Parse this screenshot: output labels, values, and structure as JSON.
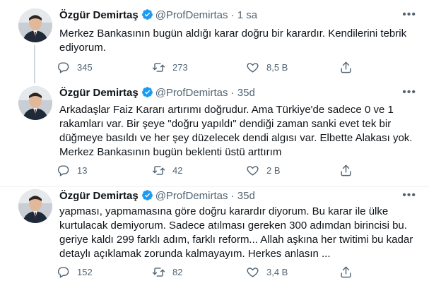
{
  "tweets": [
    {
      "name": "Özgür Demirtaş",
      "handle": "@ProfDemirtas",
      "dot": "·",
      "time": "1 sa",
      "lines": [
        "Merkez Bankasının bugün aldığı karar doğru bir karardır. Kendilerini tebrik",
        "ediyorum."
      ],
      "replies": "345",
      "retweets": "273",
      "likes": "8,5 B"
    },
    {
      "name": "Özgür Demirtaş",
      "handle": "@ProfDemirtas",
      "dot": "·",
      "time": "35d",
      "lines": [
        "Arkadaşlar Faiz Kararı artırımı doğrudur. Ama Türkiye'de sadece 0 ve 1",
        "rakamları var. Bir şeye \"doğru yapıldı\" dendiği zaman sanki evet tek bir",
        "düğmeye basıldı ve her şey düzelecek dendi algısı var. Elbette Alakası yok.",
        "Merkez Bankasının bugün beklenti üstü arttırım"
      ],
      "replies": "13",
      "retweets": "42",
      "likes": "2 B"
    },
    {
      "name": "Özgür Demirtaş",
      "handle": "@ProfDemirtas",
      "dot": "·",
      "time": "35d",
      "lines": [
        "yapması, yapmamasına göre doğru karardır diyorum. Bu karar ile ülke",
        "kurtulacak demiyorum. Sadece atılması gereken 300 adımdan birincisi bu.",
        "geriye kaldı 299 farklı adım, farklı reform... Allah aşkına her twitimi bu kadar",
        "detaylı açıklamak zorunda kalmayayım. Herkes anlasın ..."
      ],
      "replies": "152",
      "retweets": "82",
      "likes": "3,4 B"
    }
  ],
  "colors": {
    "verified": "#1d9bf0",
    "muted": "#536471",
    "thread_line": "#cfd9de"
  },
  "icons": [
    "verified-badge-icon",
    "more-icon",
    "reply-icon",
    "retweet-icon",
    "like-icon",
    "share-icon"
  ]
}
